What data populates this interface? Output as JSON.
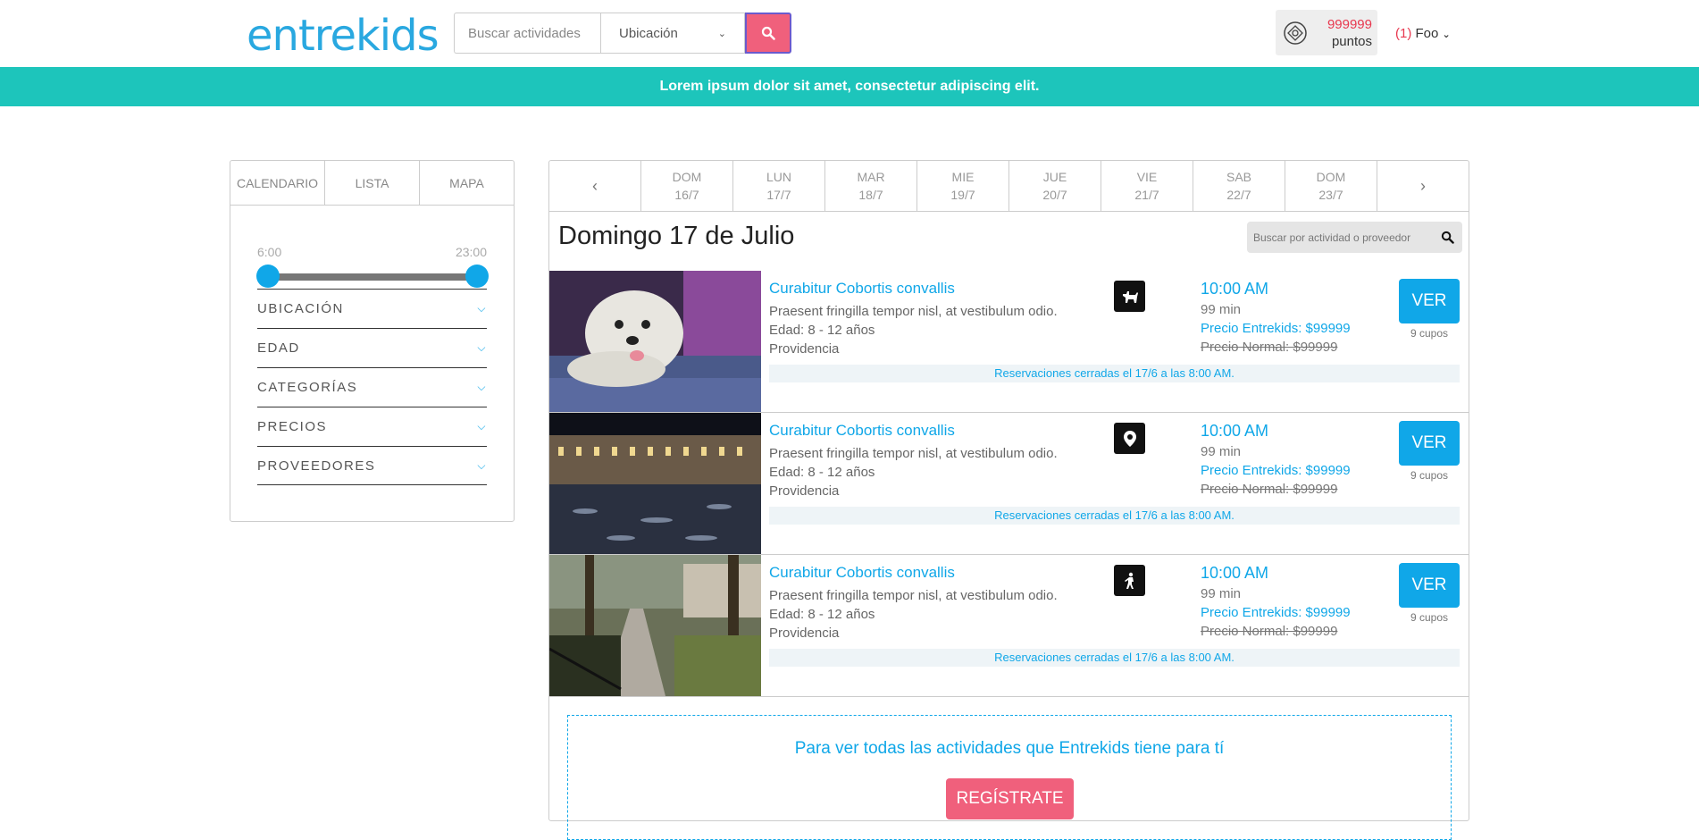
{
  "header": {
    "logo": "entrekids",
    "search_placeholder": "Buscar actividades",
    "location_label": "Ubicación",
    "points_value": "999999",
    "points_label": "puntos",
    "user_count": "(1)",
    "user_name": "Foo"
  },
  "banner": "Lorem ipsum dolor sit amet, consectetur adipiscing elit.",
  "sidebar": {
    "tabs": [
      "CALENDARIO",
      "LISTA",
      "MAPA"
    ],
    "time_start": "6:00",
    "time_end": "23:00",
    "filters": [
      "UBICACIÓN",
      "EDAD",
      "CATEGORÍAS",
      "PRECIOS",
      "PROVEEDORES"
    ]
  },
  "calendar": {
    "days": [
      {
        "day": "DOM",
        "date": "16/7"
      },
      {
        "day": "LUN",
        "date": "17/7"
      },
      {
        "day": "MAR",
        "date": "18/7"
      },
      {
        "day": "MIE",
        "date": "19/7"
      },
      {
        "day": "JUE",
        "date": "20/7"
      },
      {
        "day": "VIE",
        "date": "21/7"
      },
      {
        "day": "SAB",
        "date": "22/7"
      },
      {
        "day": "DOM",
        "date": "23/7"
      }
    ],
    "title": "Domingo 17 de Julio",
    "search_placeholder": "Buscar por actividad o proveedor"
  },
  "activities": [
    {
      "name": "Curabitur Cobortis convallis",
      "description": "Praesent fringilla tempor nisl, at vestibulum odio.",
      "age": "Edad: 8 - 12 años",
      "location": "Providencia",
      "icon": "dog-icon",
      "time": "10:00 AM",
      "duration": "99 min",
      "price_entrekids": "Precio Entrekids: $99999",
      "price_normal": "Precio Normal: $99999",
      "button": "VER",
      "cupos": "9 cupos",
      "closed_notice": "Reservaciones cerradas el 17/6 a las 8:00 AM."
    },
    {
      "name": "Curabitur Cobortis convallis",
      "description": "Praesent fringilla tempor nisl, at vestibulum odio.",
      "age": "Edad: 8 - 12 años",
      "location": "Providencia",
      "icon": "location-pin-icon",
      "time": "10:00 AM",
      "duration": "99 min",
      "price_entrekids": "Precio Entrekids: $99999",
      "price_normal": "Precio Normal: $99999",
      "button": "VER",
      "cupos": "9 cupos",
      "closed_notice": "Reservaciones cerradas el 17/6 a las 8:00 AM."
    },
    {
      "name": "Curabitur Cobortis convallis",
      "description": "Praesent fringilla tempor nisl, at vestibulum odio.",
      "age": "Edad: 8 - 12 años",
      "location": "Providencia",
      "icon": "hiking-icon",
      "time": "10:00 AM",
      "duration": "99 min",
      "price_entrekids": "Precio Entrekids: $99999",
      "price_normal": "Precio Normal: $99999",
      "button": "VER",
      "cupos": "9 cupos",
      "closed_notice": "Reservaciones cerradas el 17/6 a las 8:00 AM."
    }
  ],
  "register": {
    "text": "Para ver todas las actividades que Entrekids tiene para tí",
    "button": "REGÍSTRATE"
  }
}
